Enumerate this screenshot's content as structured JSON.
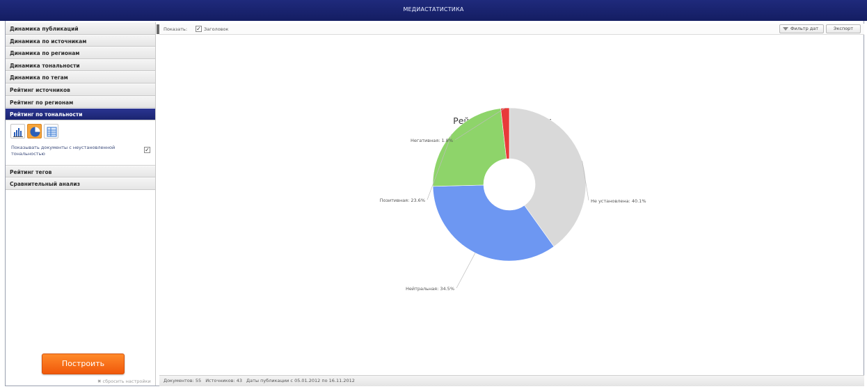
{
  "window": {
    "title": "МЕДИАСТАТИСТИКА"
  },
  "sidebar": {
    "items_top": [
      {
        "label": "Динамика публикаций"
      },
      {
        "label": "Динамика по источникам"
      },
      {
        "label": "Динамика по регионам"
      },
      {
        "label": "Динамика тональности"
      },
      {
        "label": "Динамика по тегам"
      },
      {
        "label": "Рейтинг источников"
      },
      {
        "label": "Рейтинг по регионам"
      },
      {
        "label": "Рейтинг по тональности",
        "active": true
      }
    ],
    "viz_options": {
      "selected": "pie",
      "buttons": [
        {
          "icon": "bar-chart-icon"
        },
        {
          "icon": "pie-chart-icon"
        },
        {
          "icon": "table-icon"
        }
      ],
      "option_label": "Показывать документы с неустановленной тональностью",
      "option_checked": true
    },
    "items_bottom": [
      {
        "label": "Рейтинг тегов"
      },
      {
        "label": "Сравнительный анализ"
      }
    ],
    "build_button": "Построить",
    "reset_link": "✖ сбросить настройки"
  },
  "toolbar": {
    "show_label": "Показать:",
    "header_checkbox_label": "Заголовок",
    "header_checked": true,
    "filter_button": "Фильтр дат",
    "export_button": "Экспорт"
  },
  "chart_data": {
    "type": "pie",
    "donut": true,
    "title": "Рейтинг тональности",
    "slices": [
      {
        "label": "Не установлена",
        "value": 40.1,
        "display": "Не установлена: 40.1%",
        "color": "#d9d9d9"
      },
      {
        "label": "Нейтральная",
        "value": 34.5,
        "display": "Нейтральная: 34.5%",
        "color": "#6d97f2"
      },
      {
        "label": "Позитивная",
        "value": 23.6,
        "display": "Позитивная: 23.6%",
        "color": "#8ed46a"
      },
      {
        "label": "Негативная",
        "value": 1.8,
        "display": "Негативная: 1.8%",
        "color": "#e83a3a"
      }
    ]
  },
  "status": {
    "documents": "Документов: 55",
    "sources": "Источников: 43",
    "dates": "Даты публикации с 05.01.2012 по 16.11.2012"
  }
}
